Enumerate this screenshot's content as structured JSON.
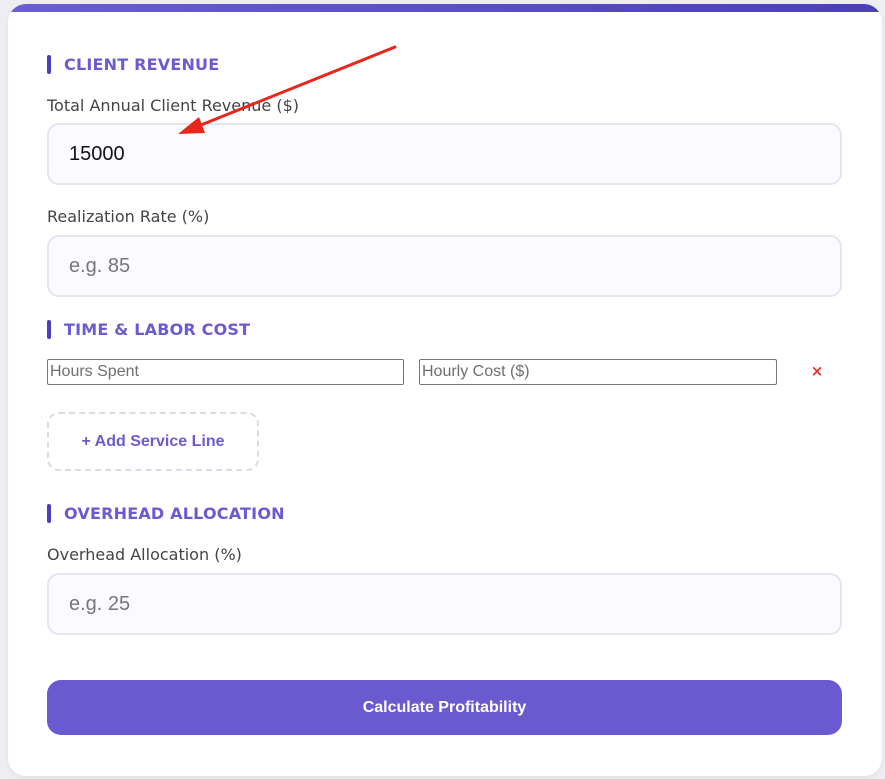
{
  "client_revenue": {
    "heading": "CLIENT REVENUE",
    "revenue_label": "Total Annual Client Revenue ($)",
    "revenue_value": "15000",
    "realization_label": "Realization Rate (%)",
    "realization_placeholder": "e.g. 85"
  },
  "time_labor": {
    "heading": "TIME & LABOR COST",
    "hours_placeholder": "Hours Spent",
    "hourly_cost_placeholder": "Hourly Cost ($)",
    "remove_label": "×",
    "add_line_label": "+ Add Service Line"
  },
  "overhead": {
    "heading": "OVERHEAD ALLOCATION",
    "overhead_label": "Overhead Allocation (%)",
    "overhead_placeholder": "e.g. 25"
  },
  "actions": {
    "calculate_label": "Calculate Profitability"
  },
  "colors": {
    "accent": "#6a5acf",
    "heading_text": "#6a5cd0",
    "remove_red": "#e0342c",
    "annotation_arrow": "#e8261c"
  },
  "icons": {
    "remove": "close-icon",
    "annotation": "red-arrow-icon"
  }
}
